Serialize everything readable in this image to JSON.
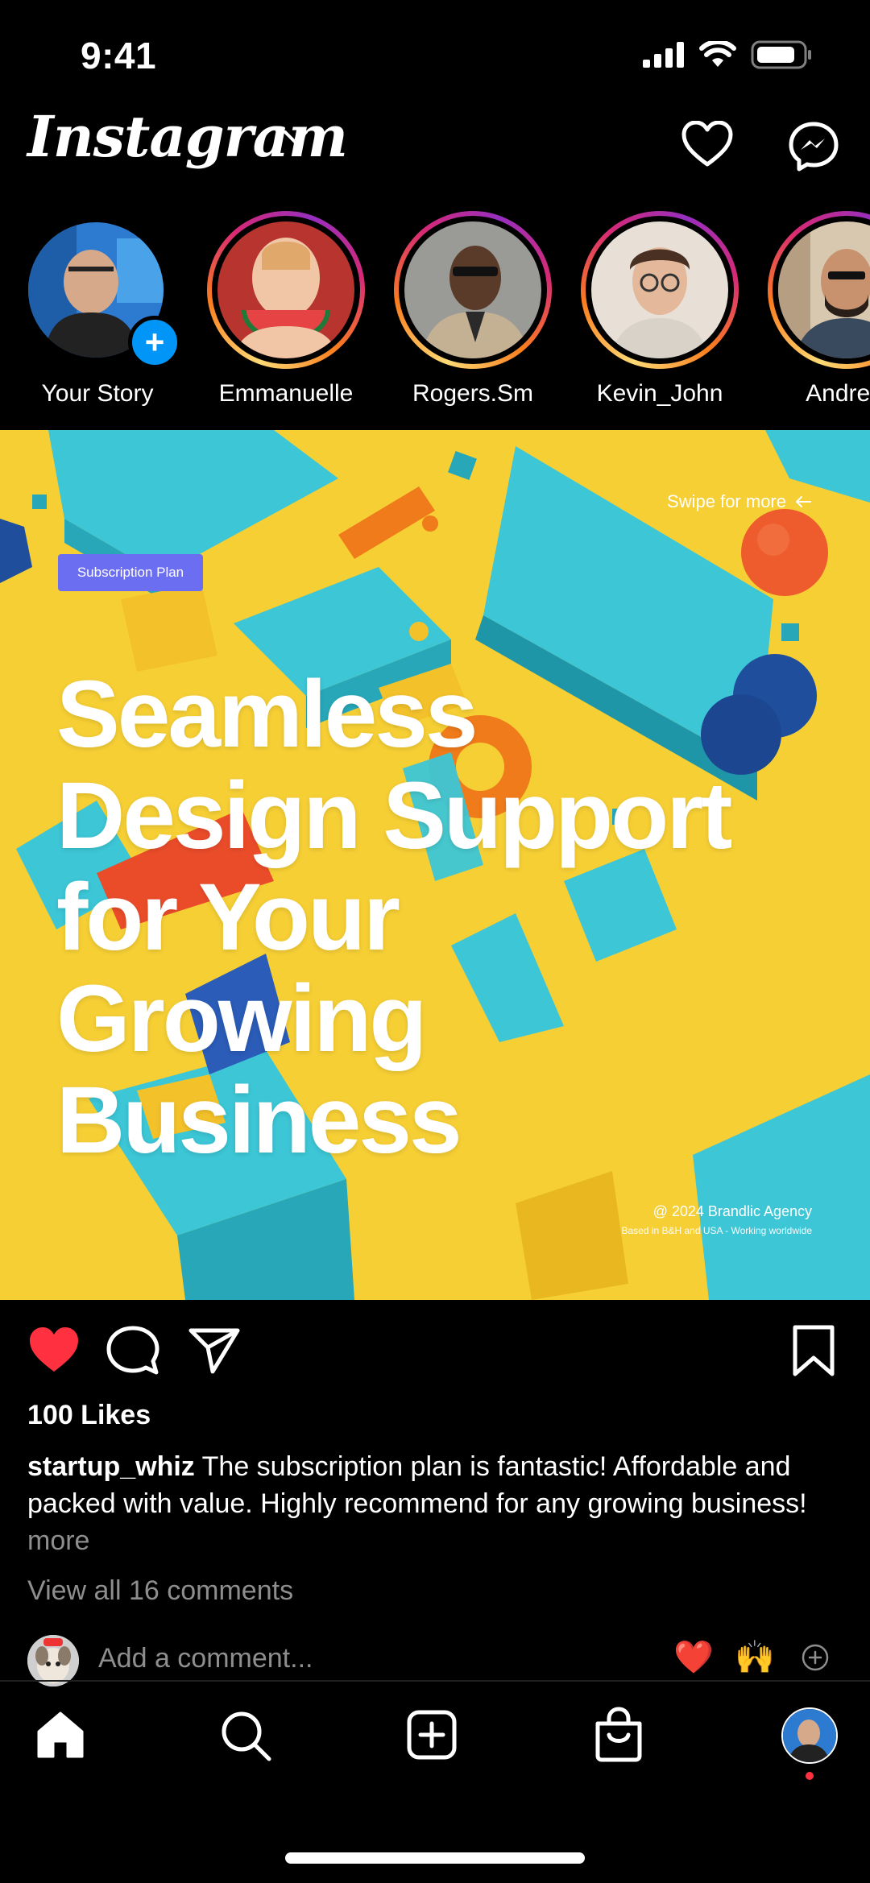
{
  "status_bar": {
    "time": "9:41"
  },
  "header": {
    "logo": "Instagram"
  },
  "stories": [
    {
      "name": "Your Story",
      "own": true
    },
    {
      "name": "Emmanuelle"
    },
    {
      "name": "Rogers.Sm"
    },
    {
      "name": "Kevin_John"
    },
    {
      "name": "Andrew"
    }
  ],
  "post": {
    "swipe_hint": "Swipe for more",
    "badge": "Subscription Plan",
    "headline_lines": [
      "Seamless",
      "Design Support",
      "for Your",
      "Growing",
      "Business"
    ],
    "credit_line1": "@ 2024 Brandlic Agency",
    "credit_line2": "Based in B&H and USA - Working worldwide"
  },
  "engagement": {
    "likes": "100 Likes",
    "caption_user": "startup_whiz",
    "caption_text": " The subscription plan is fantastic! Affordable and packed with value. Highly recommend for any growing business! ",
    "caption_more": "more",
    "view_comments": "View all 16 comments",
    "comment_placeholder": "Add a comment...",
    "quick_emojis": [
      "❤️",
      "🙌"
    ]
  },
  "colors": {
    "like_red": "#ff3040",
    "story_ring": "#d62976",
    "badge_blue": "#6b6ef0",
    "add_blue": "#0095f6",
    "post_yellow": "#f6cf35",
    "post_cyan": "#3cc6d6"
  },
  "icons": {
    "header": [
      "heart-icon",
      "messenger-icon"
    ],
    "actions": [
      "heart-filled-icon",
      "comment-icon",
      "share-icon",
      "bookmark-icon"
    ],
    "nav": [
      "home-icon",
      "search-icon",
      "create-icon",
      "shop-icon",
      "profile-avatar"
    ]
  }
}
